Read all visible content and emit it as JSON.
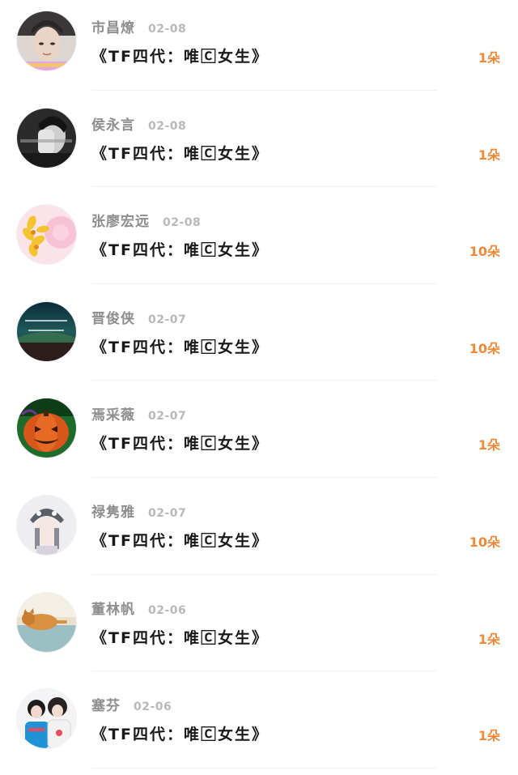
{
  "items": [
    {
      "name": "市昌燎",
      "date": "02-08",
      "title": "《TF四代：唯🄲女生》",
      "gift": "1朵",
      "avatar_icon": "boy-portrait-avatar"
    },
    {
      "name": "侯永言",
      "date": "02-08",
      "title": "《TF四代：唯🄲女生》",
      "gift": "1朵",
      "avatar_icon": "bw-hand-face-avatar"
    },
    {
      "name": "张廖宏远",
      "date": "02-08",
      "title": "《TF四代：唯🄲女生》",
      "gift": "10朵",
      "avatar_icon": "yellow-flowers-avatar"
    },
    {
      "name": "晋俊侠",
      "date": "02-07",
      "title": "《TF四代：唯🄲女生》",
      "gift": "10朵",
      "avatar_icon": "night-sky-text-avatar"
    },
    {
      "name": "焉采薇",
      "date": "02-07",
      "title": "《TF四代：唯🄲女生》",
      "gift": "1朵",
      "avatar_icon": "pumpkin-avatar"
    },
    {
      "name": "禄隽雅",
      "date": "02-07",
      "title": "《TF四代：唯🄲女生》",
      "gift": "10朵",
      "avatar_icon": "girl-penguin-hat-avatar"
    },
    {
      "name": "董林帆",
      "date": "02-06",
      "title": "《TF四代：唯🄲女生》",
      "gift": "1朵",
      "avatar_icon": "cat-avatar"
    },
    {
      "name": "塞芬",
      "date": "02-06",
      "title": "《TF四代：唯🄲女生》",
      "gift": "1朵",
      "avatar_icon": "couple-avatar"
    }
  ],
  "colors": {
    "gift": "#f0893a",
    "name": "#8e8e8e",
    "date": "#b9b9b9",
    "title": "#1a1a1a"
  }
}
